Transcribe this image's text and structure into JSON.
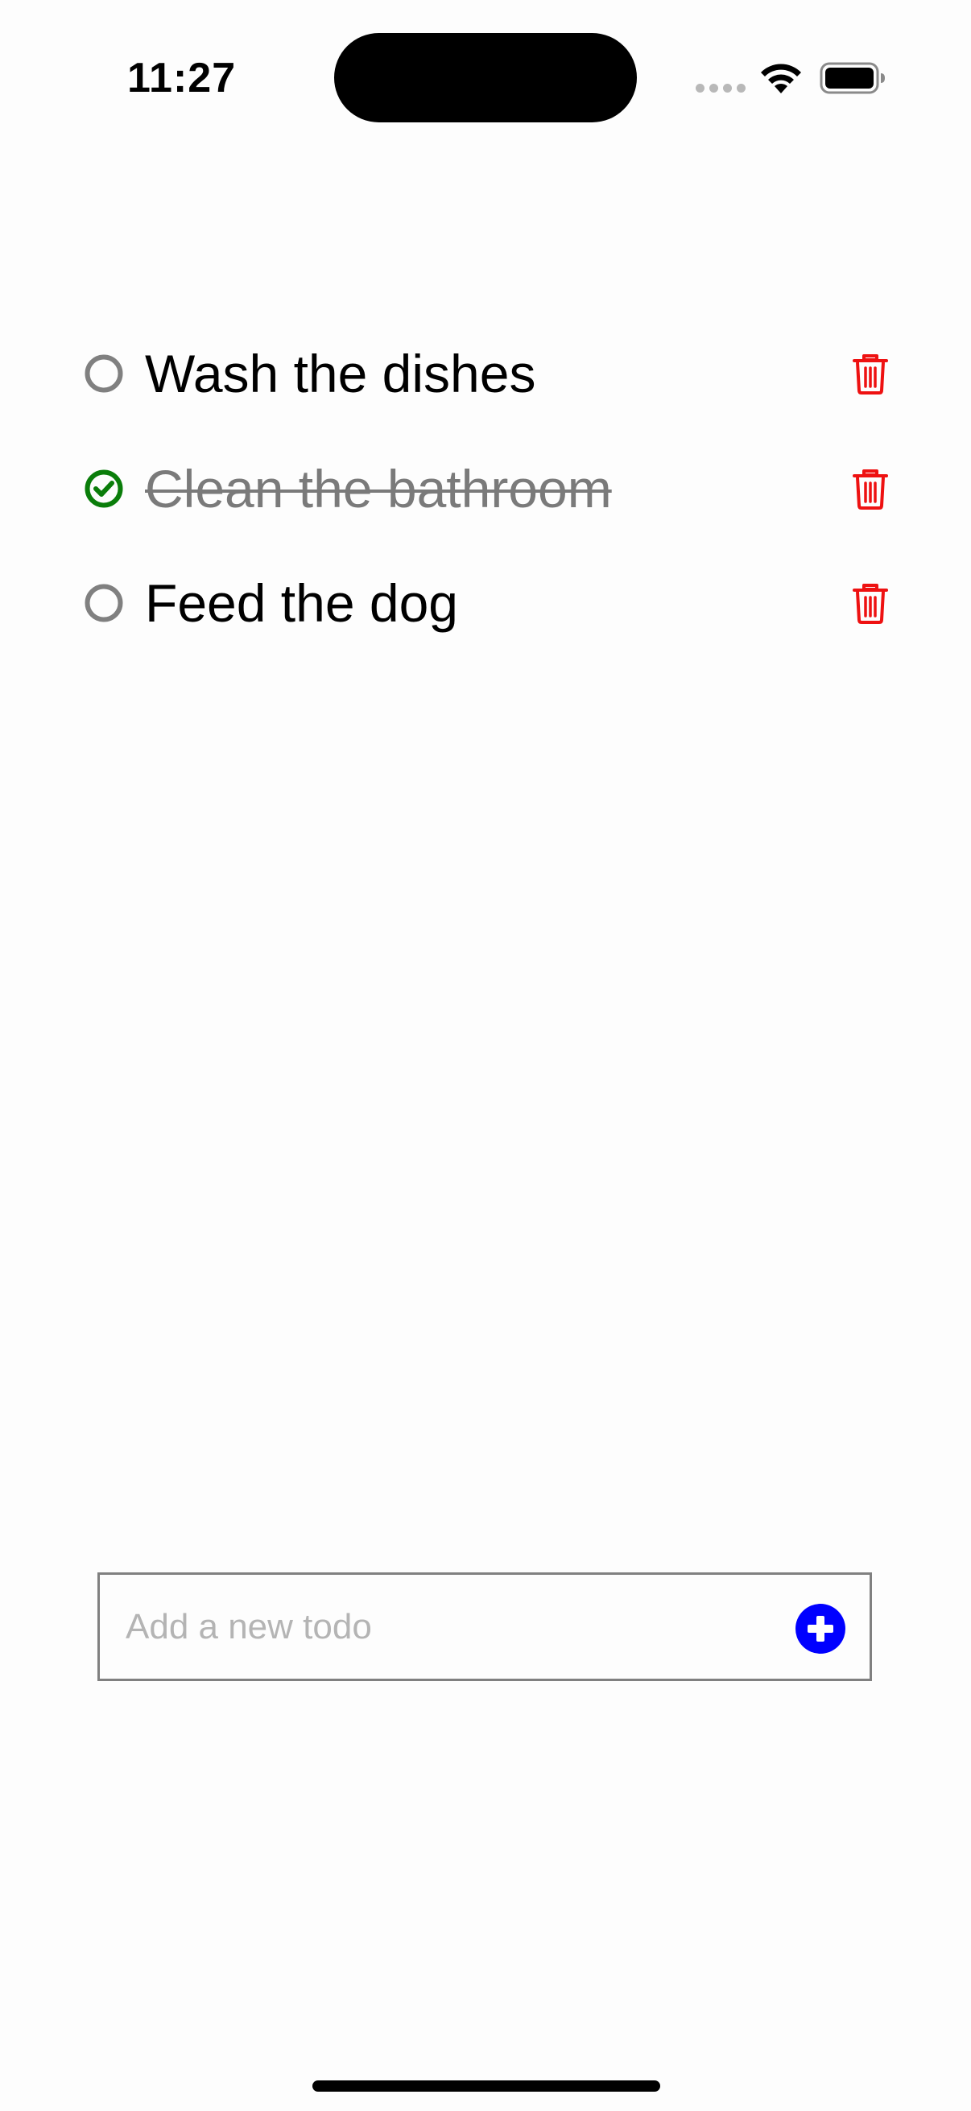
{
  "status_bar": {
    "time": "11:27"
  },
  "todos": [
    {
      "label": "Wash the dishes",
      "completed": false
    },
    {
      "label": "Clean the bathroom",
      "completed": true
    },
    {
      "label": "Feed the dog",
      "completed": false
    }
  ],
  "add_todo": {
    "placeholder": "Add a new todo",
    "value": ""
  },
  "icons": {
    "unchecked": "circle-outline-icon",
    "checked": "check-circle-icon",
    "delete": "trash-icon",
    "add": "plus-circle-icon"
  },
  "colors": {
    "unchecked_circle": "#808080",
    "checked_green": "#0a7d0a",
    "delete_red": "#ee1111",
    "add_blue": "#0000ff",
    "completed_text": "#7a7a7a",
    "placeholder": "#b4b4b4"
  }
}
